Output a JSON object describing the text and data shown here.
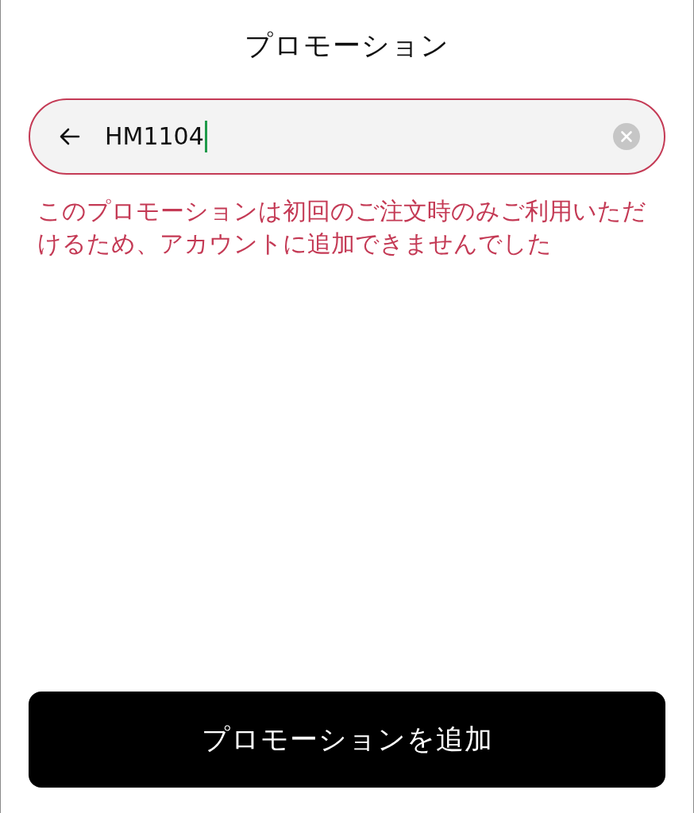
{
  "header": {
    "title": "プロモーション"
  },
  "promo_field": {
    "value": "HM1104",
    "focused": true,
    "invalid": true
  },
  "error_message": "このプロモーションは初回のご注文時のみご利用いただけるため、アカウントに追加できませんでした",
  "add_button": {
    "label": "プロモーションを追加"
  }
}
